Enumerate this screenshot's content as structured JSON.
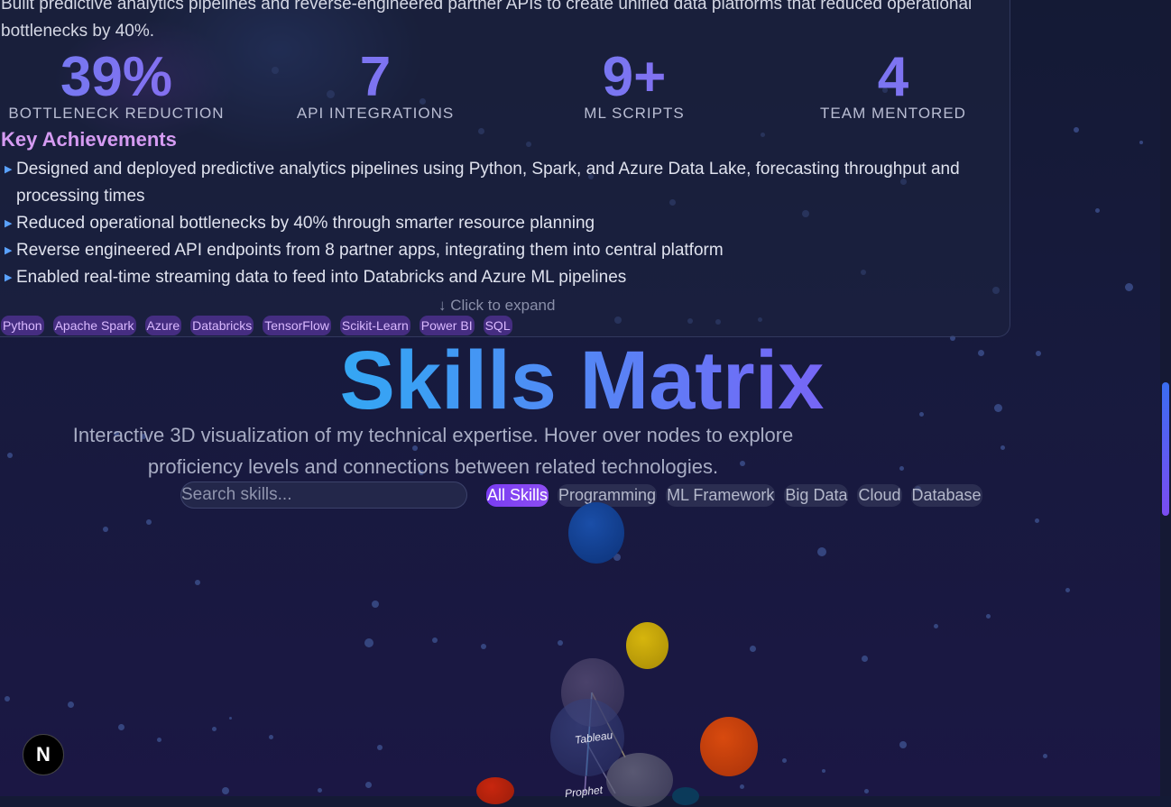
{
  "experience": {
    "description": "Built predictive analytics pipelines and reverse-engineered partner APIs to create unified data platforms that reduced operational bottlenecks by 40%.",
    "stats": [
      {
        "value": "39%",
        "label": "BOTTLENECK REDUCTION"
      },
      {
        "value": "7",
        "label": "API INTEGRATIONS"
      },
      {
        "value": "9+",
        "label": "ML SCRIPTS"
      },
      {
        "value": "4",
        "label": "TEAM MENTORED"
      }
    ],
    "achievements_title": "Key Achievements",
    "achievements": [
      "Designed and deployed predictive analytics pipelines using Python, Spark, and Azure Data Lake, forecasting throughput and processing times",
      "Reduced operational bottlenecks by 40% through smarter resource planning",
      "Reverse engineered API endpoints from 8 partner apps, integrating them into central platform",
      "Enabled real-time streaming data to feed into Databricks and Azure ML pipelines"
    ],
    "expand_label": "↓ Click to expand",
    "tags": [
      "Python",
      "Apache Spark",
      "Azure",
      "Databricks",
      "TensorFlow",
      "Scikit-Learn",
      "Power BI",
      "SQL"
    ]
  },
  "skills": {
    "title": "Skills Matrix",
    "subtitle": "Interactive 3D visualization of my technical expertise. Hover over nodes to explore proficiency levels and connections between related technologies.",
    "search_placeholder": "Search skills...",
    "filters": [
      "All Skills",
      "Programming",
      "ML Framework",
      "Big Data",
      "Cloud",
      "Database"
    ],
    "active_filter": "All Skills",
    "node_labels": [
      "Tableau",
      "Prophet"
    ]
  },
  "colors": {
    "accent": "#7b3ff2",
    "title_gradient": [
      "#18c7ef",
      "#a13ff3"
    ]
  },
  "badge": {
    "letter": "N"
  }
}
